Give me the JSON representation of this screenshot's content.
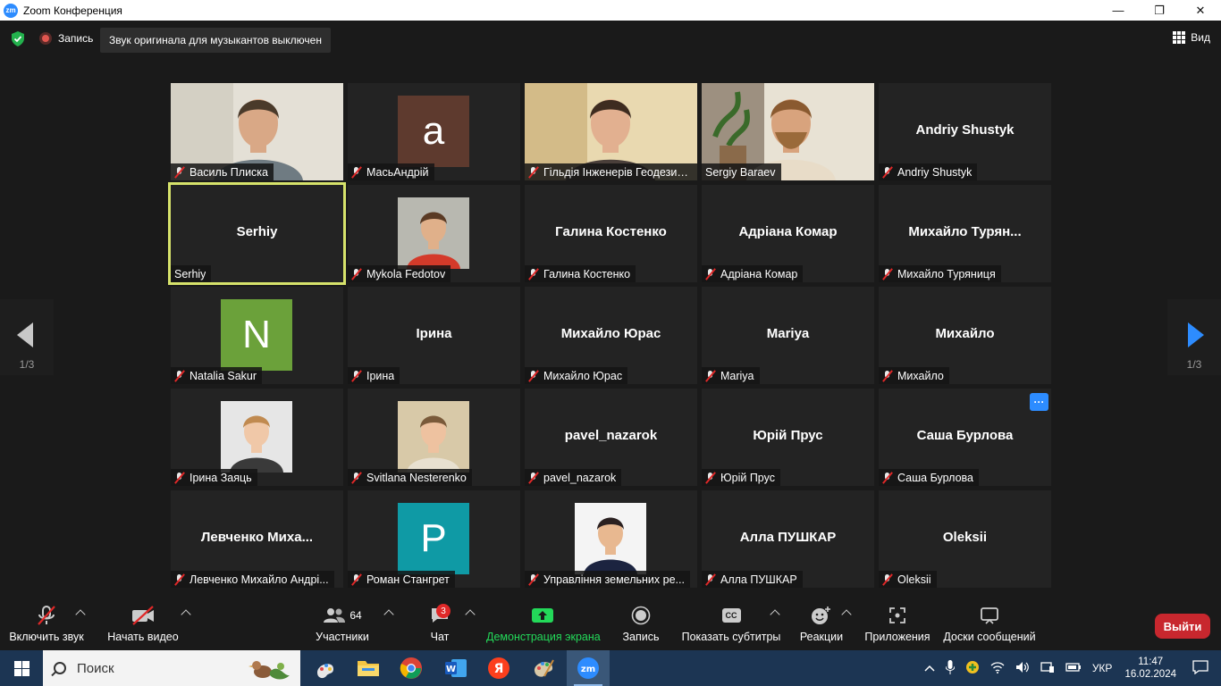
{
  "window": {
    "title": "Zoom Конференция",
    "logo": "zm",
    "minimize": "—",
    "maximize": "❐",
    "close": "✕"
  },
  "topbar": {
    "recording_label": "Запись",
    "music_mode": "Звук оригинала для музыкантов выключен",
    "view_label": "Вид"
  },
  "pagination": {
    "left": "1/3",
    "right": "1/3"
  },
  "tiles": [
    {
      "kind": "video",
      "label": "Василь Плиска",
      "muted": true
    },
    {
      "kind": "avatar",
      "letter": "a",
      "color": "#5e3a2e",
      "label": "МасьАндрій",
      "muted": true
    },
    {
      "kind": "video",
      "label": "Гільдія Інженерів Геодезист...",
      "muted": true
    },
    {
      "kind": "video",
      "label": "Sergiy Baraev",
      "muted": false
    },
    {
      "kind": "name",
      "name": "Andriy Shustyk",
      "label": "Andriy Shustyk",
      "muted": true
    },
    {
      "kind": "name",
      "name": "Serhiy",
      "label": "Serhiy",
      "muted": false,
      "active": true
    },
    {
      "kind": "photo",
      "label": "Mykola Fedotov",
      "muted": true
    },
    {
      "kind": "name",
      "name": "Галина Костенко",
      "label": "Галина Костенко",
      "muted": true
    },
    {
      "kind": "name",
      "name": "Адріана Комар",
      "label": "Адріана Комар",
      "muted": true
    },
    {
      "kind": "name",
      "name": "Михайло  Турян...",
      "label": "Михайло Туряниця",
      "muted": true
    },
    {
      "kind": "avatar",
      "letter": "N",
      "color": "#6ba13a",
      "label": "Natalia Sakur",
      "muted": true
    },
    {
      "kind": "name",
      "name": "Ірина",
      "label": "Ірина",
      "muted": true
    },
    {
      "kind": "name",
      "name": "Михайло Юрас",
      "label": "Михайло Юрас",
      "muted": true
    },
    {
      "kind": "name",
      "name": "Mariya",
      "label": "Mariya",
      "muted": true
    },
    {
      "kind": "name",
      "name": "Михайло",
      "label": "Михайло",
      "muted": true
    },
    {
      "kind": "photo",
      "label": "Ірина Заяць",
      "muted": true
    },
    {
      "kind": "photo",
      "label": "Svitlana Nesterenko",
      "muted": true
    },
    {
      "kind": "name",
      "name": "pavel_nazarok",
      "label": "pavel_nazarok",
      "muted": true
    },
    {
      "kind": "name",
      "name": "Юрій Прус",
      "label": "Юрій Прус",
      "muted": true
    },
    {
      "kind": "name",
      "name": "Саша Бурлова",
      "label": "Саша Бурлова",
      "muted": true,
      "more": "···"
    },
    {
      "kind": "name",
      "name": "Левченко  Миха...",
      "label": "Левченко Михайло Андрі...",
      "muted": true
    },
    {
      "kind": "avatar",
      "letter": "P",
      "color": "#0f9aa5",
      "label": "Роман Стангрет",
      "muted": true
    },
    {
      "kind": "photo",
      "label": "Управління земельних ре...",
      "muted": true
    },
    {
      "kind": "name",
      "name": "Алла ПУШКАР",
      "label": "Алла ПУШКАР",
      "muted": true
    },
    {
      "kind": "name",
      "name": "Oleksii",
      "label": "Oleksii",
      "muted": true
    }
  ],
  "toolbar": {
    "unmute": "Включить звук",
    "start_video": "Начать видео",
    "participants": "Участники",
    "participants_count": "64",
    "chat": "Чат",
    "chat_badge": "3",
    "share": "Демонстрация экрана",
    "record": "Запись",
    "captions": "Показать субтитры",
    "captions_icon": "CC",
    "reactions": "Реакции",
    "apps": "Приложения",
    "whiteboards": "Доски сообщений",
    "leave": "Выйти"
  },
  "taskbar": {
    "search_placeholder": "Поиск",
    "tray_lang": "УКР",
    "time": "11:47",
    "date": "16.02.2024",
    "apps": [
      "paint-3d",
      "file-explorer",
      "chrome",
      "word",
      "yandex-browser",
      "paint",
      "zoom"
    ]
  }
}
